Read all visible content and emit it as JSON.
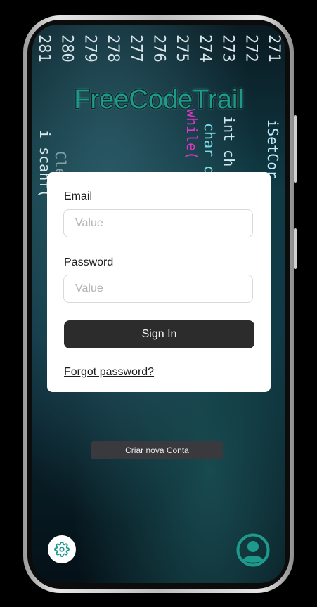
{
  "background": {
    "line_numbers": [
      "281",
      "280",
      "279",
      "278",
      "277",
      "276",
      "275",
      "274",
      "273",
      "272",
      "271"
    ],
    "code_fragments": [
      "i scanf(",
      "while(",
      "char c",
      "int ch",
      "iSetCor",
      "ClearC"
    ]
  },
  "app": {
    "title": "FreeCodeTrail"
  },
  "login_form": {
    "email_label": "Email",
    "email_placeholder": "Value",
    "password_label": "Password",
    "password_placeholder": "Value",
    "sign_in_label": "Sign In",
    "forgot_password_label": "Forgot password?"
  },
  "create_account_label": "Criar nova Conta",
  "icons": {
    "settings": "gear-icon",
    "profile": "user-circle-icon"
  },
  "colors": {
    "accent": "#1e9a8c",
    "button_dark": "#2c2c2c",
    "create_button": "#3a3a3e"
  }
}
